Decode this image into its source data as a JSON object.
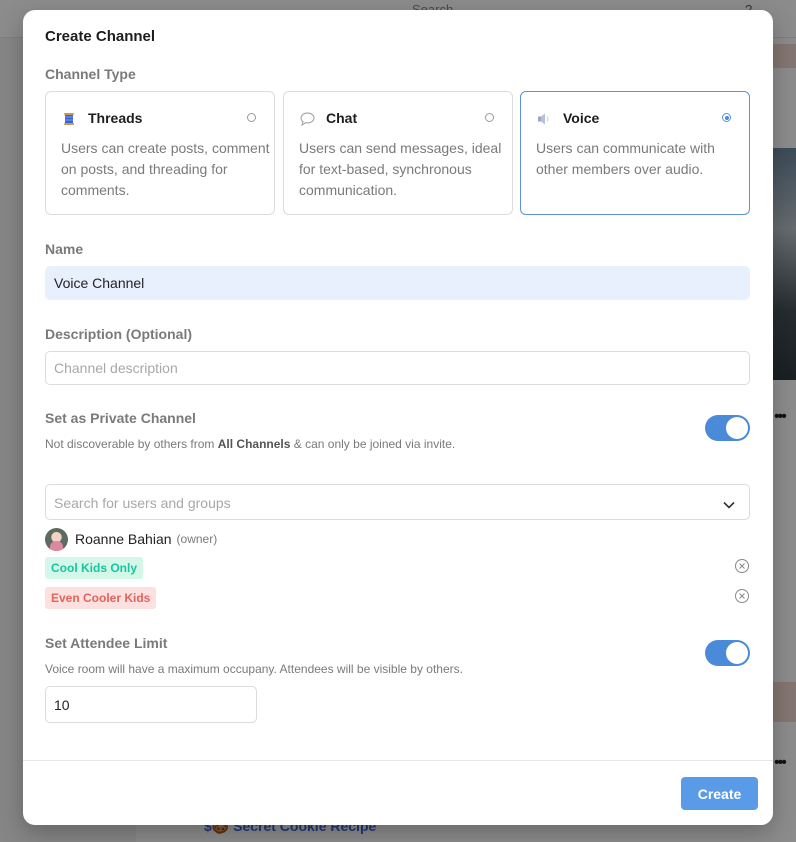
{
  "background": {
    "search_label": "Search",
    "help_label": "?",
    "link_text": "$🍪 Secret Cookie Recipe",
    "dots": "•••"
  },
  "modal": {
    "title": "Create Channel",
    "channel_type_label": "Channel Type",
    "channel_types": [
      {
        "title": "Threads",
        "icon": "spool-icon",
        "description": "Users can create posts, comment on posts, and threading for comments.",
        "selected": false
      },
      {
        "title": "Chat",
        "icon": "speech-bubble-icon",
        "description": "Users can send messages, ideal for text-based, synchronous communication.",
        "selected": false
      },
      {
        "title": "Voice",
        "icon": "speaker-icon",
        "description": "Users can communicate with other members over audio.",
        "selected": true
      }
    ],
    "name_label": "Name",
    "name_value": "Voice Channel",
    "description_label": "Description (Optional)",
    "description_placeholder": "Channel description",
    "private": {
      "label": "Set as Private Channel",
      "hint_prefix": "Not discoverable by others from ",
      "hint_bold": "All Channels",
      "hint_suffix": " & can only be joined via invite.",
      "enabled": true
    },
    "search_placeholder": "Search for users and groups",
    "member": {
      "name": "Roanne Bahian",
      "role": "(owner)"
    },
    "groups": [
      {
        "name": "Cool Kids Only",
        "color": "#17c69b"
      },
      {
        "name": "Even Cooler Kids",
        "color": "#e2645d"
      }
    ],
    "attendee": {
      "label": "Set Attendee Limit",
      "hint": "Voice room will have a maximum occupany. Attendees will be visible by others.",
      "value": "10",
      "enabled": true
    },
    "create_label": "Create",
    "accent_color": "#4a8ad9"
  }
}
